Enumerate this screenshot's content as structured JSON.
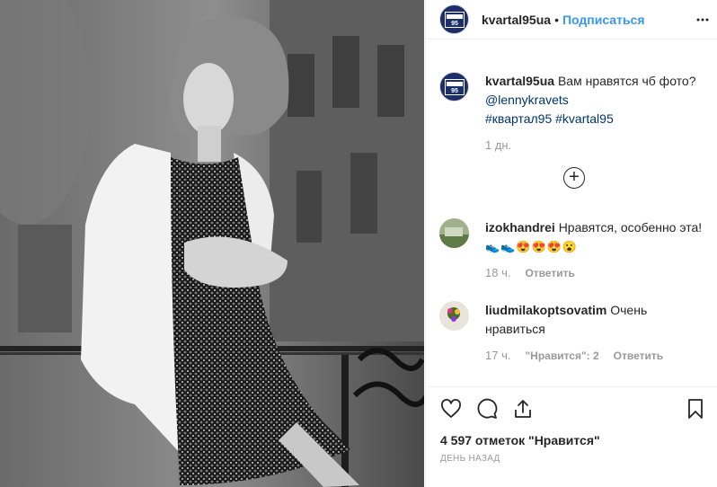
{
  "post": {
    "username": "kvartal95ua",
    "dot": "•",
    "follow_label": "Подписаться",
    "more_icon": "more-horizontal-icon",
    "logo_text": "КВАРТАЛ 95"
  },
  "caption": {
    "username": "kvartal95ua",
    "text": "Вам нравятся чб фото?",
    "mention": "@lennykravets",
    "hashtag_1": "#квартал95",
    "hashtag_2": "#kvartal95",
    "time": "1 дн."
  },
  "load_more": {
    "icon": "plus-circle-icon",
    "symbol": "+"
  },
  "comments": [
    {
      "username": "izokhandrei",
      "text": "Нравятся, особенно эта!",
      "emoji": "👟👟😍😍😍😮",
      "time": "18 ч.",
      "reply_label": "Ответить"
    },
    {
      "username": "liudmilakoptsovatim",
      "text": "Очень нравиться",
      "time": "17 ч.",
      "likes_label": "\"Нравится\": 2",
      "reply_label": "Ответить"
    }
  ],
  "actions": {
    "icons": [
      "heart-icon",
      "comment-icon",
      "share-icon",
      "bookmark-icon"
    ],
    "likes": "4 597 отметок \"Нравится\"",
    "date": "день назад"
  },
  "colors": {
    "link": "#003569",
    "follow": "#3897f0",
    "muted": "#999999",
    "text": "#262626",
    "brand_bg": "#1d2f6b"
  }
}
